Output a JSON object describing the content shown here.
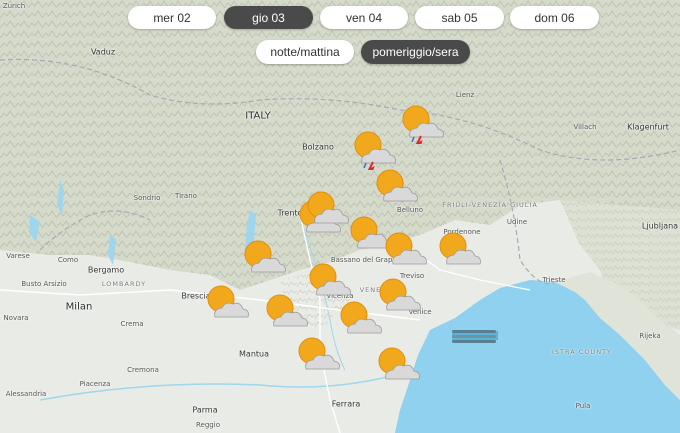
{
  "day_tabs": [
    {
      "label": "mer 02",
      "active": false
    },
    {
      "label": "gio 03",
      "active": true
    },
    {
      "label": "ven 04",
      "active": false
    },
    {
      "label": "sab 05",
      "active": false
    },
    {
      "label": "dom 06",
      "active": false
    }
  ],
  "period_tabs": [
    {
      "label": "notte/mattina",
      "active": false
    },
    {
      "label": "pomeriggio/sera",
      "active": true
    }
  ],
  "map_labels": {
    "zurich": "Zurich",
    "vaduz": "Vaduz",
    "italy": "ITALY",
    "bolzano": "Bolzano",
    "lienz": "Lienz",
    "villach": "Villach",
    "klagenfurt": "Klagenfurt",
    "trento": "Trento",
    "belluno": "Belluno",
    "udine": "Udine",
    "ljubljana": "Ljubljana",
    "pordenone": "Pordenone",
    "friuli": "FRIULI-VENEZIA GIULIA",
    "sondrio": "Sondrio",
    "tirano": "Tirano",
    "varese": "Varese",
    "como": "Como",
    "bergamo": "Bergamo",
    "lombardy": "LOMBARDY",
    "milan": "Milan",
    "brescia": "Brescia",
    "bassano": "Bassano del Grappa",
    "treviso": "Treviso",
    "vicenza": "Vicenza",
    "veneto": "VENETO",
    "trieste": "Trieste",
    "venice": "Venice",
    "novara": "Novara",
    "crema": "Crema",
    "mantua": "Mantua",
    "cremona": "Cremona",
    "piacenza": "Piacenza",
    "parma": "Parma",
    "reggio": "Reggio",
    "alessandria": "Alessandria",
    "ferrara": "Ferrara",
    "rijeka": "Rijeka",
    "istra": "ISTRA COUNTY",
    "pula": "Pula",
    "busto": "Busto Arsizio"
  },
  "weather_markers": [
    {
      "icon": "partly-cloudy-thunder-icon",
      "condition": "sun-cloud-thunder"
    },
    {
      "icon": "partly-cloudy-thunder-icon",
      "condition": "sun-cloud-thunder"
    },
    {
      "icon": "partly-cloudy-icon",
      "condition": "sun-cloud"
    },
    {
      "icon": "partly-cloudy-icon",
      "condition": "sun-cloud"
    },
    {
      "icon": "partly-cloudy-icon",
      "condition": "sun-cloud"
    },
    {
      "icon": "partly-cloudy-icon",
      "condition": "sun-cloud"
    },
    {
      "icon": "partly-cloudy-icon",
      "condition": "sun-cloud"
    },
    {
      "icon": "partly-cloudy-icon",
      "condition": "sun-cloud"
    },
    {
      "icon": "partly-cloudy-icon",
      "condition": "sun-cloud"
    },
    {
      "icon": "partly-cloudy-icon",
      "condition": "sun-cloud"
    },
    {
      "icon": "partly-cloudy-icon",
      "condition": "sun-cloud"
    },
    {
      "icon": "partly-cloudy-icon",
      "condition": "sun-cloud"
    },
    {
      "icon": "partly-cloudy-icon",
      "condition": "sun-cloud"
    },
    {
      "icon": "partly-cloudy-icon",
      "condition": "sun-cloud"
    },
    {
      "icon": "partly-cloudy-icon",
      "condition": "sun-cloud"
    },
    {
      "icon": "partly-cloudy-icon",
      "condition": "sun-cloud"
    },
    {
      "icon": "fog-icon",
      "condition": "fog"
    }
  ],
  "colors": {
    "land": "#e9ebe6",
    "mountains": "#cdd3c3",
    "sea": "#8fd1ef",
    "active_tab": "#4a4a4a",
    "sun": "#f2a81d",
    "cloud": "#d9d9d9",
    "lightning": "#e0262b"
  }
}
